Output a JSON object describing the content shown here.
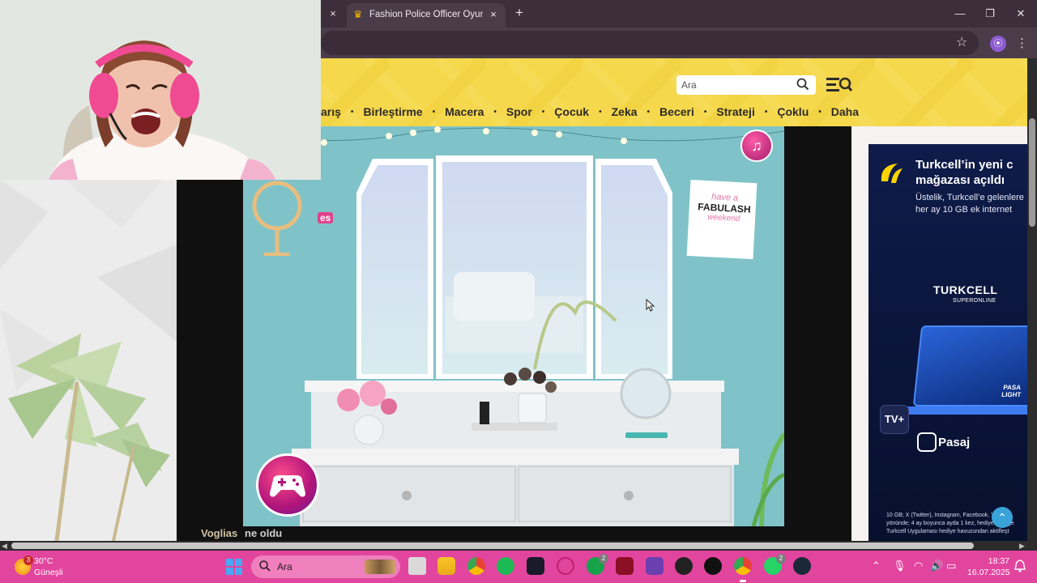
{
  "browser": {
    "active_tab_title": "Fashion Police Officer Oyunu - O",
    "prev_tab_close": "×",
    "tab_close": "×",
    "new_tab": "+",
    "window_controls": {
      "minimize": "—",
      "maximize": "❐",
      "close": "✕"
    }
  },
  "site": {
    "search": {
      "placeholder": "Ara"
    },
    "nav": [
      "arış",
      "Birleştirme",
      "Macera",
      "Spor",
      "Çocuk",
      "Zeka",
      "Beceri",
      "Strateji",
      "Çoklu",
      "Daha"
    ],
    "game_logo_fragment": "es",
    "poster_text": {
      "line1": "have a",
      "line2": "FABULASH",
      "line3": "weekend"
    },
    "caption": {
      "user": "Voglias",
      "message": "ne oldu"
    }
  },
  "ad": {
    "title_line1": "Turkcell’in yeni c",
    "title_line2": "mağazası açıldı",
    "sub_line1": "Üstelik, Turkcell’e gelenlere",
    "sub_line2": "her ay 10 GB ek internet",
    "brand": "TURKCELL",
    "brand_sub": "SUPERONLINE",
    "tv_badge": "TV+",
    "pasaj": "Pasaj",
    "screen_text": "PASA LIGHT",
    "fineprint": "10 GB; X (Twitter), Instagram, Facebook, Youtube yönünde; 4 ay boyunca ayda 1 kez, hediyesonu ge Turkcell Uygulaması hediye havuzundan aktifleşt"
  },
  "taskbar": {
    "weather": {
      "badge": "3",
      "temp": "30°C",
      "condition": "Güneşli"
    },
    "search_label": "Ara",
    "xbox_badge": "2",
    "whatsapp_badge": "2",
    "time": "18:37",
    "date": "16.07.2025"
  },
  "colors": {
    "header_yellow": "#f5d84c",
    "game_teal": "#7fc3c9",
    "taskbar_pink": "#e2459e",
    "ad_navy": "#0f1b4a"
  }
}
